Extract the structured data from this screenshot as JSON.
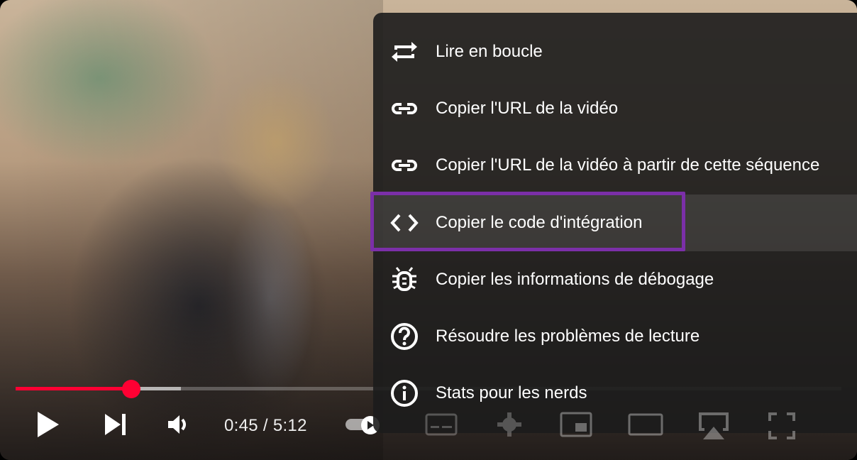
{
  "player": {
    "time_display": "0:45 / 5:12",
    "played_fraction": 0.14,
    "buffered_fraction": 0.2,
    "accent_color": "#ff0033",
    "highlight_color": "#7b2fa8"
  },
  "controls": [
    {
      "name": "play-button",
      "icon": "play-icon"
    },
    {
      "name": "next-button",
      "icon": "skip-next-icon"
    },
    {
      "name": "volume-button",
      "icon": "volume-icon"
    },
    {
      "name": "autoplay-toggle",
      "icon": "autoplay-icon"
    },
    {
      "name": "subtitles-button",
      "icon": "subtitles-icon"
    },
    {
      "name": "settings-button",
      "icon": "gear-icon"
    },
    {
      "name": "miniplayer-button",
      "icon": "miniplayer-icon"
    },
    {
      "name": "theater-button",
      "icon": "theater-icon"
    },
    {
      "name": "cast-button",
      "icon": "airplay-icon"
    },
    {
      "name": "fullscreen-button",
      "icon": "fullscreen-icon"
    }
  ],
  "menu": {
    "items": [
      {
        "label": "Lire en boucle",
        "icon": "loop-icon"
      },
      {
        "label": "Copier l'URL de la vidéo",
        "icon": "link-icon"
      },
      {
        "label": "Copier l'URL de la vidéo à partir de cette séquence",
        "icon": "link-icon"
      },
      {
        "label": "Copier le code d'intégration",
        "icon": "embed-code-icon",
        "active": true
      },
      {
        "label": "Copier les informations de débogage",
        "icon": "bug-icon"
      },
      {
        "label": "Résoudre les problèmes de lecture",
        "icon": "help-circle-icon"
      },
      {
        "label": "Stats pour les nerds",
        "icon": "info-icon"
      }
    ]
  }
}
